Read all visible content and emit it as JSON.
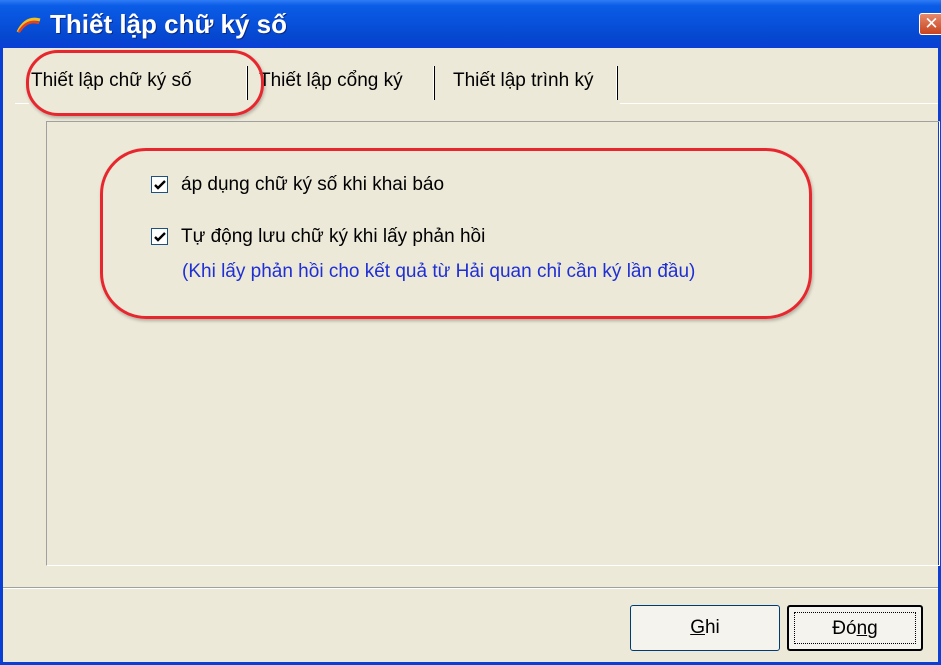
{
  "window": {
    "title": "Thiết lập chữ ký số",
    "app_icon": "arc-logo-icon",
    "close_glyph": "✕"
  },
  "tabs": [
    {
      "label": "Thiết lập chữ ký số",
      "active": true
    },
    {
      "label": "Thiết lập cổng ký",
      "active": false
    },
    {
      "label": "Thiết lập trình ký",
      "active": false
    }
  ],
  "settings": {
    "apply_signature": {
      "label": "áp dụng chữ ký số khi khai báo",
      "checked": true
    },
    "auto_save": {
      "label": "Tự động lưu chữ ký khi lấy phản hồi",
      "checked": true
    },
    "note": "(Khi lấy phản hồi cho kết quả từ Hải quan chỉ cần ký lần đầu)"
  },
  "buttons": {
    "save": {
      "accel": "G",
      "rest": "hi"
    },
    "close": {
      "pre": "Đó",
      "accel": "n",
      "post": "g"
    }
  },
  "colors": {
    "titlebar": "#0a5ce6",
    "window_bg": "#ece9d8",
    "note_text": "#1f2fd4",
    "highlight": "#e8262e"
  }
}
